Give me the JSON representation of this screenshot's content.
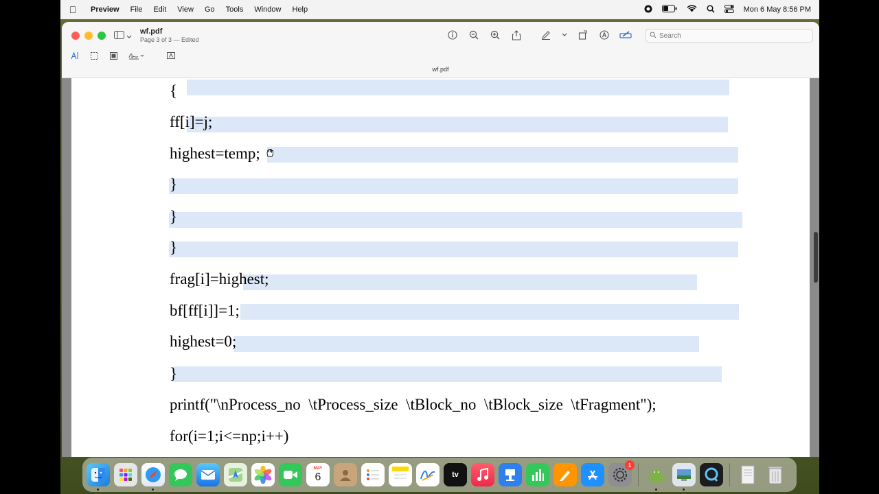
{
  "menubar": {
    "app_name": "Preview",
    "items": [
      "File",
      "Edit",
      "View",
      "Go",
      "Tools",
      "Window",
      "Help"
    ],
    "clock": "Mon 6 May  8:56 PM"
  },
  "window": {
    "doc_name": "wf.pdf",
    "doc_subtitle": "Page 3 of 3 — Edited",
    "tab_title": "wf.pdf",
    "search_placeholder": "Search"
  },
  "code_lines": [
    "{",
    "ff[i]=j;",
    "highest=temp;",
    "}",
    "}",
    "}",
    "frag[i]=highest;",
    "bf[ff[i]]=1;",
    "highest=0;",
    "}",
    "printf(\"\\nProcess_no  \\tProcess_size  \\tBlock_no  \\tBlock_size  \\tFragment\");",
    "for(i=1;i<=np;i++)"
  ],
  "dock": {
    "calendar_month": "MAY",
    "calendar_day": "6",
    "tv_label": "tv",
    "settings_badge": "1"
  },
  "colors": {
    "highlight": "#dce7f8",
    "accent": "#2f6fd3"
  }
}
